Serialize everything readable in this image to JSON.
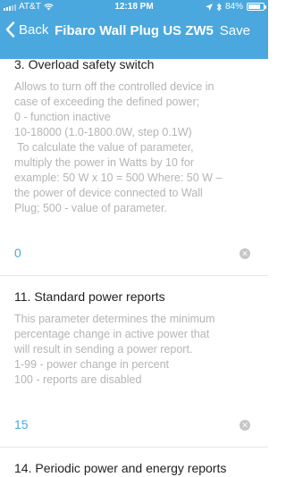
{
  "status_bar": {
    "carrier": "AT&T",
    "time": "12:18 PM",
    "battery": "84%",
    "battery_level": 0.84
  },
  "nav": {
    "back_label": "Back",
    "title": "Fibaro Wall Plug US ZW5",
    "save_label": "Save"
  },
  "params": [
    {
      "title": "3. Overload safety switch",
      "description_lines": [
        "Allows to turn off the controlled device in",
        "case of exceeding the defined power;",
        "0 - function inactive",
        "10-18000 (1.0-1800.0W, step 0.1W)",
        " To calculate the value of parameter,",
        "multiply the power in Watts by 10 for",
        "example: 50 W x 10 = 500 Where: 50 W –",
        "the power of device connected to Wall",
        "Plug; 500 - value of parameter."
      ],
      "value": "0"
    },
    {
      "title": "11. Standard power reports",
      "description_lines": [
        "This parameter determines the minimum",
        "percentage change in active power that",
        "will result in sending a power report.",
        "1-99 - power change in percent",
        "100 - reports are disabled"
      ],
      "value": "15"
    },
    {
      "title": "14. Periodic power and energy reports"
    }
  ]
}
